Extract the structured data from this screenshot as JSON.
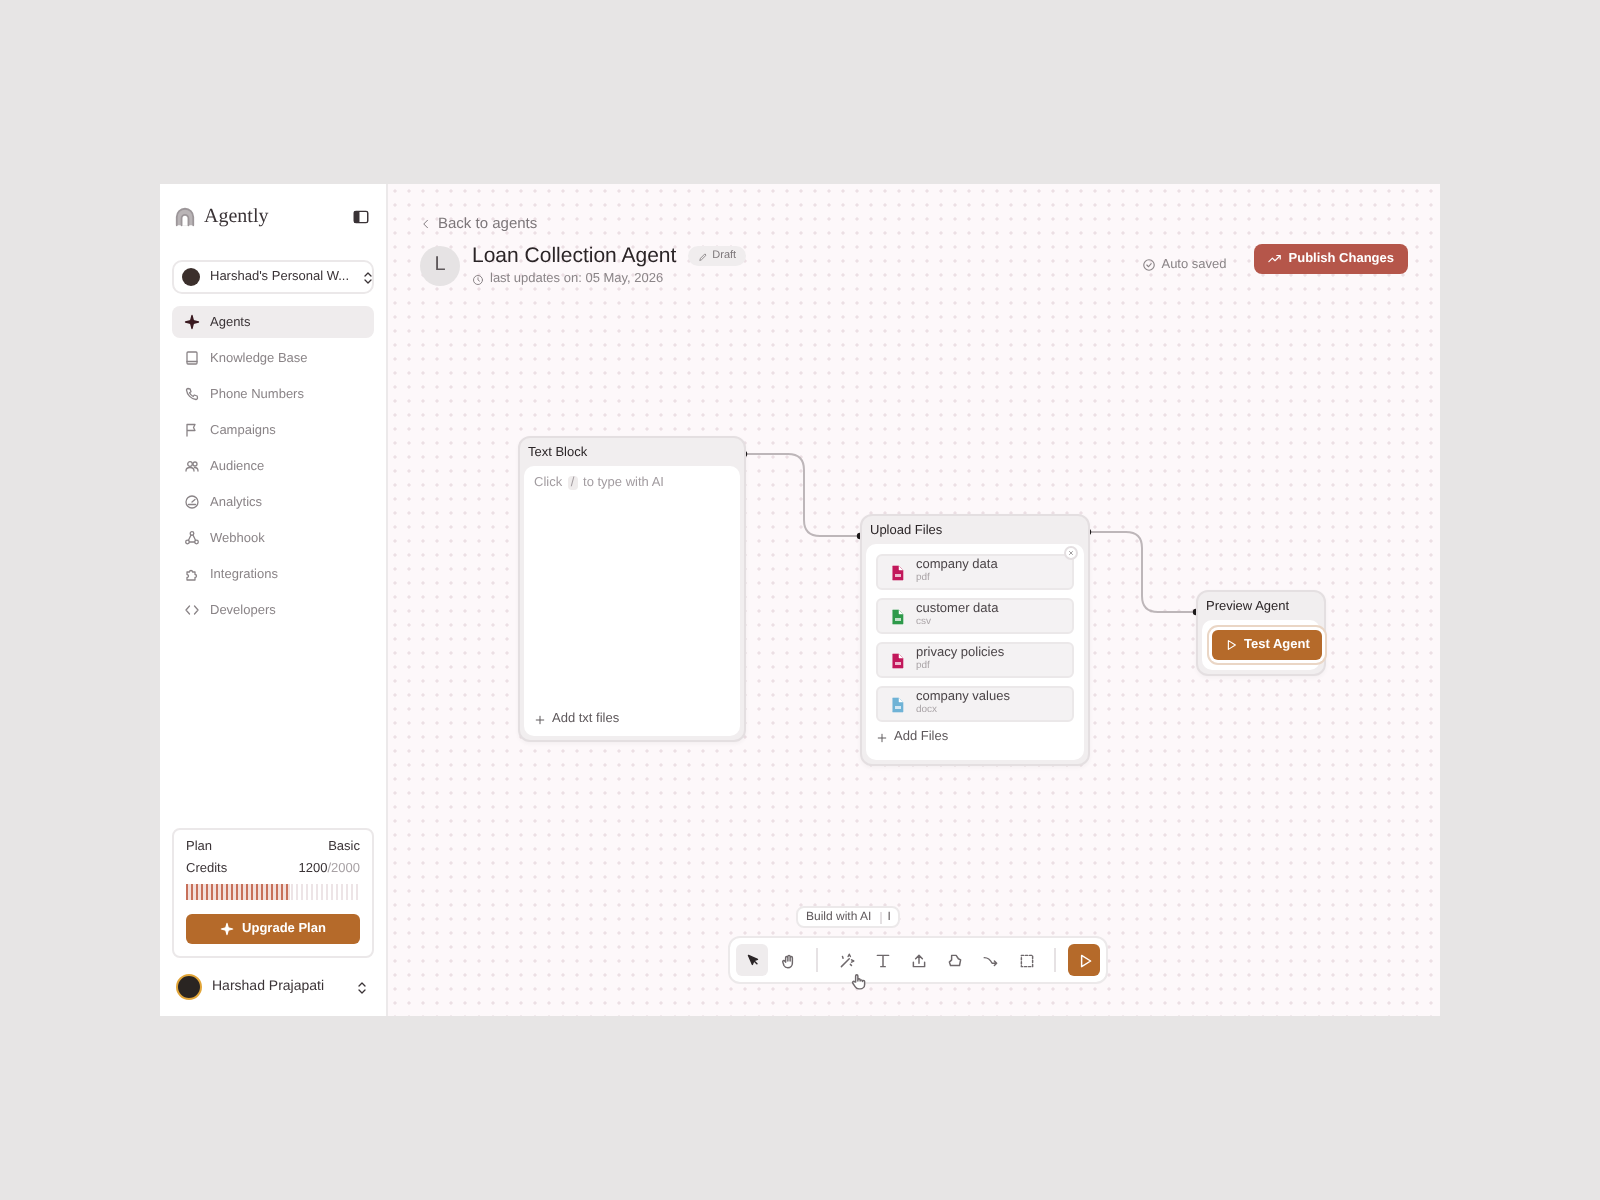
{
  "app": {
    "name": "Agently"
  },
  "workspace": {
    "label": "Harshad's Personal W..."
  },
  "sidebar": {
    "items": [
      {
        "label": "Agents",
        "selected": true
      },
      {
        "label": "Knowledge Base",
        "selected": false
      },
      {
        "label": "Phone Numbers",
        "selected": false
      },
      {
        "label": "Campaigns",
        "selected": false
      },
      {
        "label": "Audience",
        "selected": false
      },
      {
        "label": "Analytics",
        "selected": false
      },
      {
        "label": "Webhook",
        "selected": false
      },
      {
        "label": "Integrations",
        "selected": false
      },
      {
        "label": "Developers",
        "selected": false
      }
    ]
  },
  "plan": {
    "label": "Plan",
    "value": "Basic",
    "credits_label": "Credits",
    "credits_used": "1200",
    "credits_total": "/2000",
    "level": 0.6,
    "button": "Upgrade Plan"
  },
  "user": {
    "name": "Harshad Prajapati"
  },
  "header": {
    "back": "Back to agents",
    "avatar_letter": "L",
    "title": "Loan Collection Agent",
    "badge": "Draft",
    "updated": "last updates on: 05 May, 2026",
    "status": "Auto saved",
    "publish": "Publish Changes"
  },
  "text_block": {
    "title": "Text Block",
    "hint_before": "Click",
    "hint_key": "/",
    "hint_after": "to type with AI",
    "add": "Add txt files"
  },
  "upload_files": {
    "title": "Upload Files",
    "files": [
      {
        "name": "company data",
        "type": "pdf",
        "color": "#c2185b"
      },
      {
        "name": "customer data",
        "type": "csv",
        "color": "#2e9a4a"
      },
      {
        "name": "privacy policies",
        "type": "pdf",
        "color": "#c2185b"
      },
      {
        "name": "company values",
        "type": "docx",
        "color": "#6fb3d6"
      }
    ],
    "add": "Add Files"
  },
  "preview_agent": {
    "title": "Preview Agent",
    "button": "Test Agent"
  },
  "toolbar": {
    "tag": "Build with AI",
    "tag_key": "I",
    "tools": [
      {
        "kind": "pointer",
        "selected": true
      },
      {
        "kind": "hand",
        "selected": false
      },
      {
        "kind": "magic",
        "selected": false
      },
      {
        "kind": "text",
        "selected": false
      },
      {
        "kind": "upload",
        "selected": false
      },
      {
        "kind": "shape",
        "selected": false
      },
      {
        "kind": "connector",
        "selected": false
      },
      {
        "kind": "frame",
        "selected": false
      },
      {
        "kind": "run",
        "selected": false
      }
    ]
  }
}
